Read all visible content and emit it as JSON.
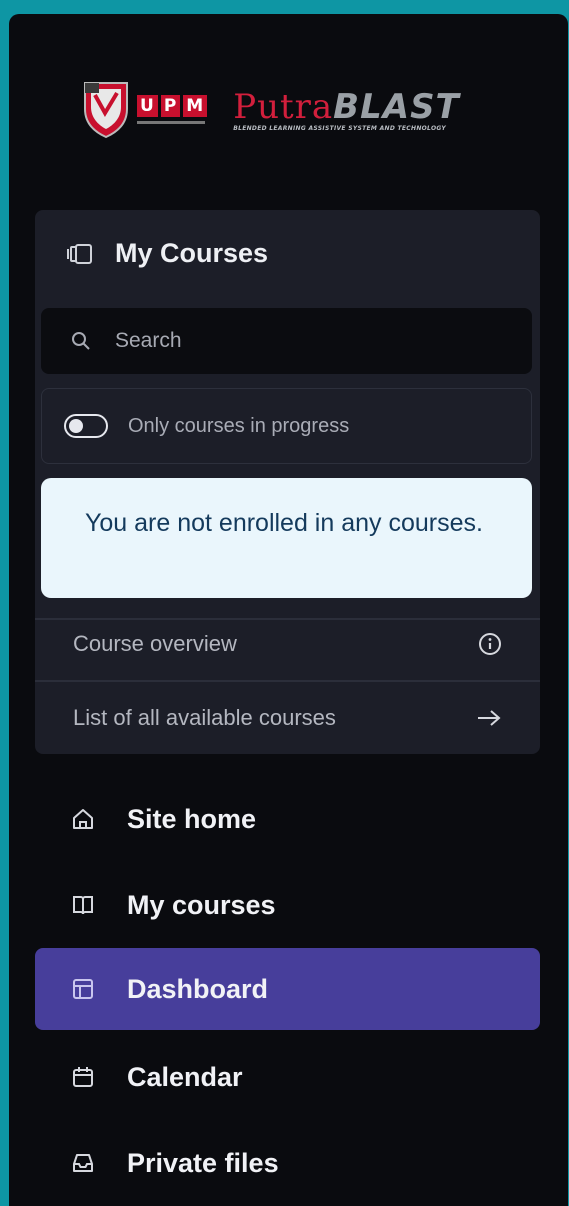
{
  "branding": {
    "upm_letters": [
      "U",
      "P",
      "M"
    ],
    "putra_part1": "Putra",
    "putra_part2": "BLAST",
    "putra_tagline": "BLENDED LEARNING ASSISTIVE SYSTEM AND TECHNOLOGY",
    "colors": {
      "red": "#d21f3c",
      "grey": "#9aa0a6"
    }
  },
  "courses_block": {
    "title": "My Courses",
    "title_icon": "course-book-icon",
    "search_placeholder": "Search",
    "search_icon": "search-icon",
    "toggle_label": "Only courses in progress",
    "toggle_state": "off",
    "empty_message": "You are not enrolled in any courses.",
    "course_overview_label": "Course overview",
    "course_overview_icon": "info-icon",
    "all_courses_label": "List of all available courses",
    "all_courses_icon": "arrow-right-icon"
  },
  "nav": {
    "items": [
      {
        "label": "Site home",
        "icon": "home-icon",
        "active": false
      },
      {
        "label": "My courses",
        "icon": "book-icon",
        "active": false
      },
      {
        "label": "Dashboard",
        "icon": "dashboard-icon",
        "active": true
      },
      {
        "label": "Calendar",
        "icon": "calendar-icon",
        "active": false
      },
      {
        "label": "Private files",
        "icon": "inbox-icon",
        "active": false
      }
    ]
  },
  "colors": {
    "background": "#0a0b0f",
    "frame": "#0e96a4",
    "card": "#1c1e28",
    "active": "#473e9b",
    "alert_bg": "#eaf6fc",
    "alert_text": "#143a5c"
  }
}
